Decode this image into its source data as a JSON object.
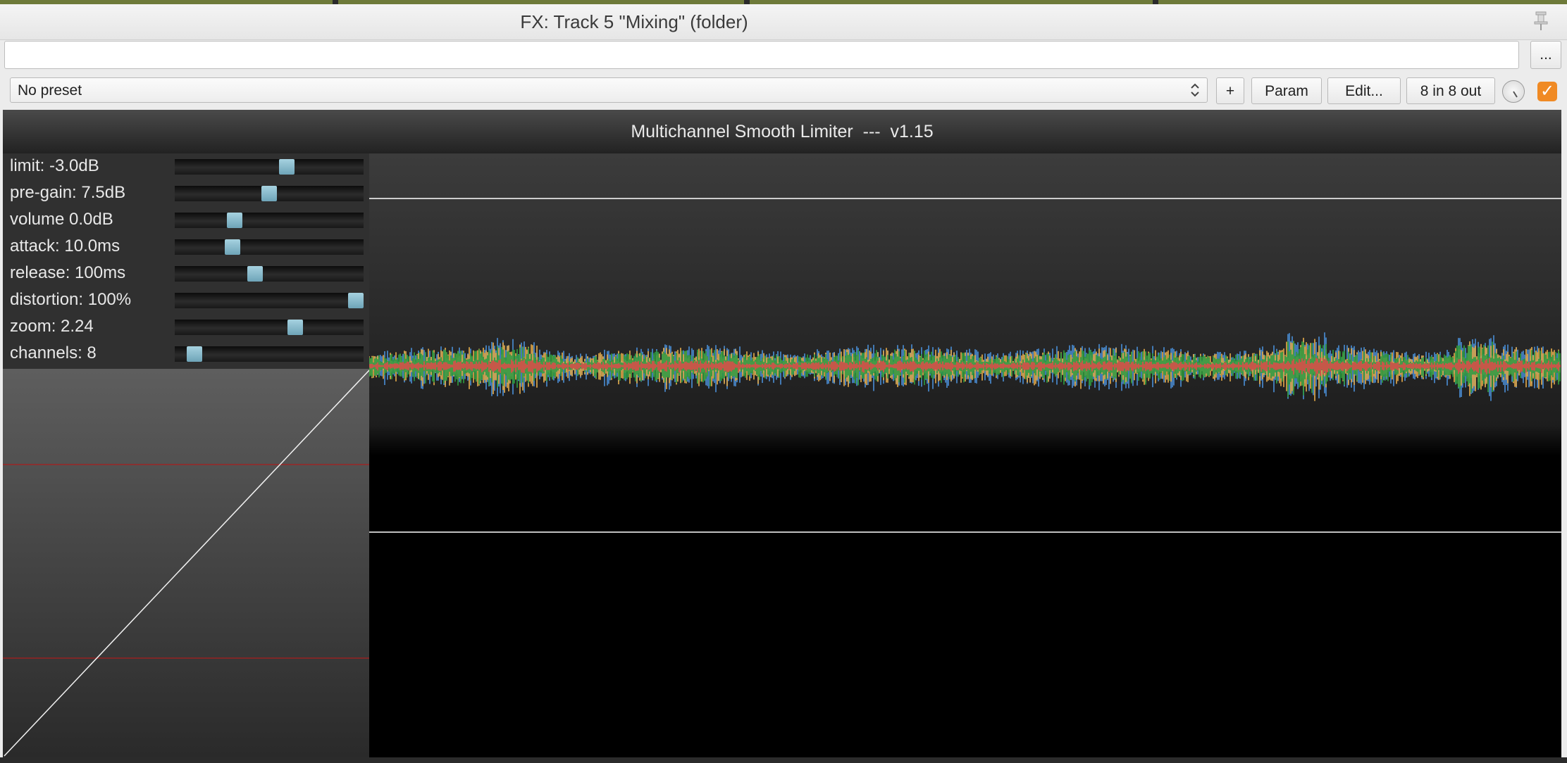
{
  "window": {
    "title": "FX: Track 5 \"Mixing\" (folder)",
    "pin_icon": "pin-icon"
  },
  "toolbar": {
    "search_value": "",
    "more_label": "...",
    "preset": "No preset",
    "add_label": "+",
    "param_label": "Param",
    "edit_label": "Edit...",
    "io_label": "8 in 8 out",
    "enabled": true
  },
  "plugin": {
    "title": "Multichannel Smooth Limiter  ---  v1.15",
    "parameters": [
      {
        "label": "limit: -3.0dB",
        "position": 0.6
      },
      {
        "label": "pre-gain: 7.5dB",
        "position": 0.5
      },
      {
        "label": "volume 0.0dB",
        "position": 0.3
      },
      {
        "label": "attack: 10.0ms",
        "position": 0.29
      },
      {
        "label": "release: 100ms",
        "position": 0.42
      },
      {
        "label": "distortion: 100%",
        "position": 1.0
      },
      {
        "label": "zoom: 2.24",
        "position": 0.65
      },
      {
        "label": "channels: 8",
        "position": 0.07
      }
    ],
    "waveform_colors": [
      "#4a8fd8",
      "#e8ad4a",
      "#2e9e3e",
      "#e04848"
    ],
    "limit_line_color": "#ffffff",
    "curve_reference_color": "#aa1e1e"
  }
}
